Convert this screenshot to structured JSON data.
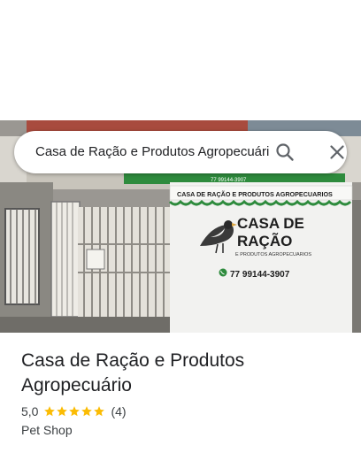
{
  "search": {
    "query": "Casa de Ração e Produtos Agropecuário"
  },
  "photo": {
    "sign_top": "CASA DE RAÇÃO E PRODUTOS AGROPECUARIOS",
    "sign_brand_line1": "CASA DE",
    "sign_brand_line2": "RAÇÃO",
    "sign_subtitle": "E PRODUTOS AGROPECUARIOS",
    "sign_phone": "77 99144-3907",
    "banner_phone_small": "77 99144-3907"
  },
  "place": {
    "title": "Casa de Ração e Produtos Agropecuário",
    "rating": "5,0",
    "stars": 5,
    "review_count": "(4)",
    "category": "Pet Shop"
  },
  "colors": {
    "star": "#fbbc04",
    "sign_green": "#2e8b3d",
    "accent_text": "#202124"
  },
  "icons": {
    "search": "search-icon",
    "close": "close-icon",
    "star": "star-icon",
    "whatsapp": "whatsapp-icon",
    "bird": "bird-logo"
  }
}
